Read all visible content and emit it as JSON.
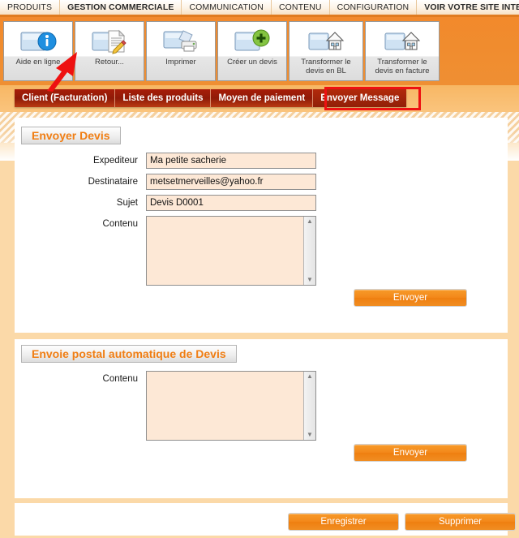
{
  "menubar": {
    "items": [
      {
        "label": "PRODUITS",
        "bold": false
      },
      {
        "label": "GESTION COMMERCIALE",
        "bold": true
      },
      {
        "label": "COMMUNICATION",
        "bold": false
      },
      {
        "label": "CONTENU",
        "bold": false
      },
      {
        "label": "CONFIGURATION",
        "bold": false
      },
      {
        "label": "VOIR VOTRE SITE INTERNET",
        "bold": true
      }
    ]
  },
  "toolbar": {
    "buttons": [
      {
        "label": "Aide en ligne",
        "icon": "info-icon"
      },
      {
        "label": "Retour...",
        "icon": "document-edit-icon"
      },
      {
        "label": "Imprimer",
        "icon": "printer-icon"
      },
      {
        "label": "Créer un devis",
        "icon": "add-plus-icon"
      },
      {
        "label": "Transformer le devis en BL",
        "icon": "house-icon"
      },
      {
        "label": "Transformer le devis en facture",
        "icon": "house-icon"
      }
    ]
  },
  "tabs": [
    {
      "label": "Client (Facturation)",
      "active": false
    },
    {
      "label": "Liste des produits",
      "active": false
    },
    {
      "label": "Moyen de paiement",
      "active": false
    },
    {
      "label": "Envoyer Message",
      "active": true
    }
  ],
  "section_send_quote": {
    "title": "Envoyer Devis",
    "fields": [
      {
        "label": "Expediteur",
        "value": "Ma petite sacherie",
        "placeholder": ""
      },
      {
        "label": "Destinataire",
        "value": "metsetmerveilles@yahoo.fr",
        "placeholder": ""
      },
      {
        "label": "Sujet",
        "value": "Devis D0001",
        "placeholder": ""
      }
    ],
    "content_label": "Contenu",
    "content_value": "",
    "send_label": "Envoyer"
  },
  "section_auto_postal": {
    "title": "Envoie postal automatique de Devis",
    "content_label": "Contenu",
    "content_value": "",
    "send_label": "Envoyer"
  },
  "footer": {
    "save_label": "Enregistrer",
    "delete_label": "Supprimer"
  },
  "annotations": {
    "arrow_color": "#ee1111",
    "highlight_box_color": "#ee1111",
    "highlight_target": "Envoyer Message"
  },
  "colors": {
    "toolbar_orange": "#f08c2e",
    "tab_dark_red": "#a81d09",
    "section_title_orange": "#f07e14",
    "button_orange": "#f3881a",
    "field_peach": "#fde8d6",
    "content_band": "#fbd9a8"
  }
}
